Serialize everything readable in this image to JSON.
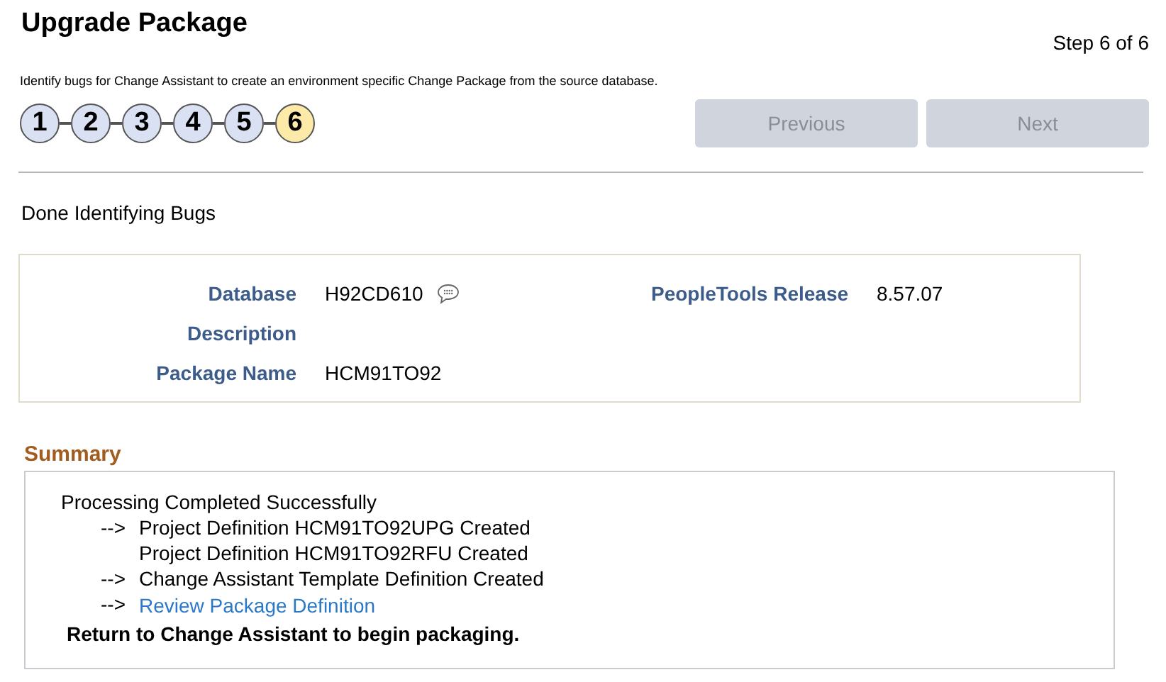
{
  "title": "Upgrade Package",
  "step_indicator": "Step 6 of 6",
  "instructions": "Identify bugs for Change Assistant to create an environment specific Change Package from the source database.",
  "steps": [
    {
      "label": "1",
      "selected": false
    },
    {
      "label": "2",
      "selected": false
    },
    {
      "label": "3",
      "selected": false
    },
    {
      "label": "4",
      "selected": false
    },
    {
      "label": "5",
      "selected": false
    },
    {
      "label": "6",
      "selected": true
    }
  ],
  "buttons": [
    {
      "label": "Previous",
      "disabled": true
    },
    {
      "label": "Next",
      "disabled": true
    }
  ],
  "status": "Done Identifying Bugs",
  "details": [
    [
      {
        "label": "Database",
        "value": "H92CD610",
        "comment": true
      },
      {
        "label": "Description"
      },
      {
        "label": "Package Name",
        "value": "HCM91TO92"
      }
    ],
    [
      {
        "label": "PeopleTools Release",
        "value": "8.57.07"
      }
    ]
  ],
  "summary": {
    "heading": "Summary",
    "lines": [
      {
        "kind": "text",
        "text": "Processing Completed Successfully"
      },
      {
        "kind": "item",
        "arrow": "-->",
        "text": "Project Definition HCM91TO92UPG Created"
      },
      {
        "kind": "item",
        "text": "Project Definition HCM91TO92RFU Created"
      },
      {
        "kind": "item",
        "arrow": "-->",
        "text": "Change Assistant Template Definition Created"
      },
      {
        "kind": "link",
        "arrow": "-->",
        "text": "Review Package Definition"
      }
    ],
    "note": "Return to Change Assistant to begin packaging."
  }
}
